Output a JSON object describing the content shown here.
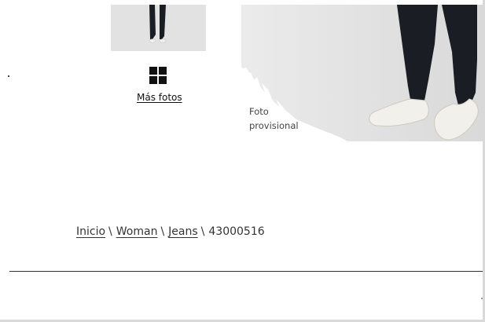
{
  "gallery": {
    "more_photos_label": "Más fotos",
    "placeholder_caption_line1": "Foto",
    "placeholder_caption_line2": "provisional",
    "grid_icon": "grid-icon"
  },
  "breadcrumb": {
    "items": [
      "Inicio",
      "Woman",
      "Jeans"
    ],
    "current": "43000516"
  },
  "colors": {
    "text": "#333333",
    "jeans": "#1b1d24",
    "shoe": "#f2f0ea",
    "photo_bg": "#e4e4e4"
  }
}
